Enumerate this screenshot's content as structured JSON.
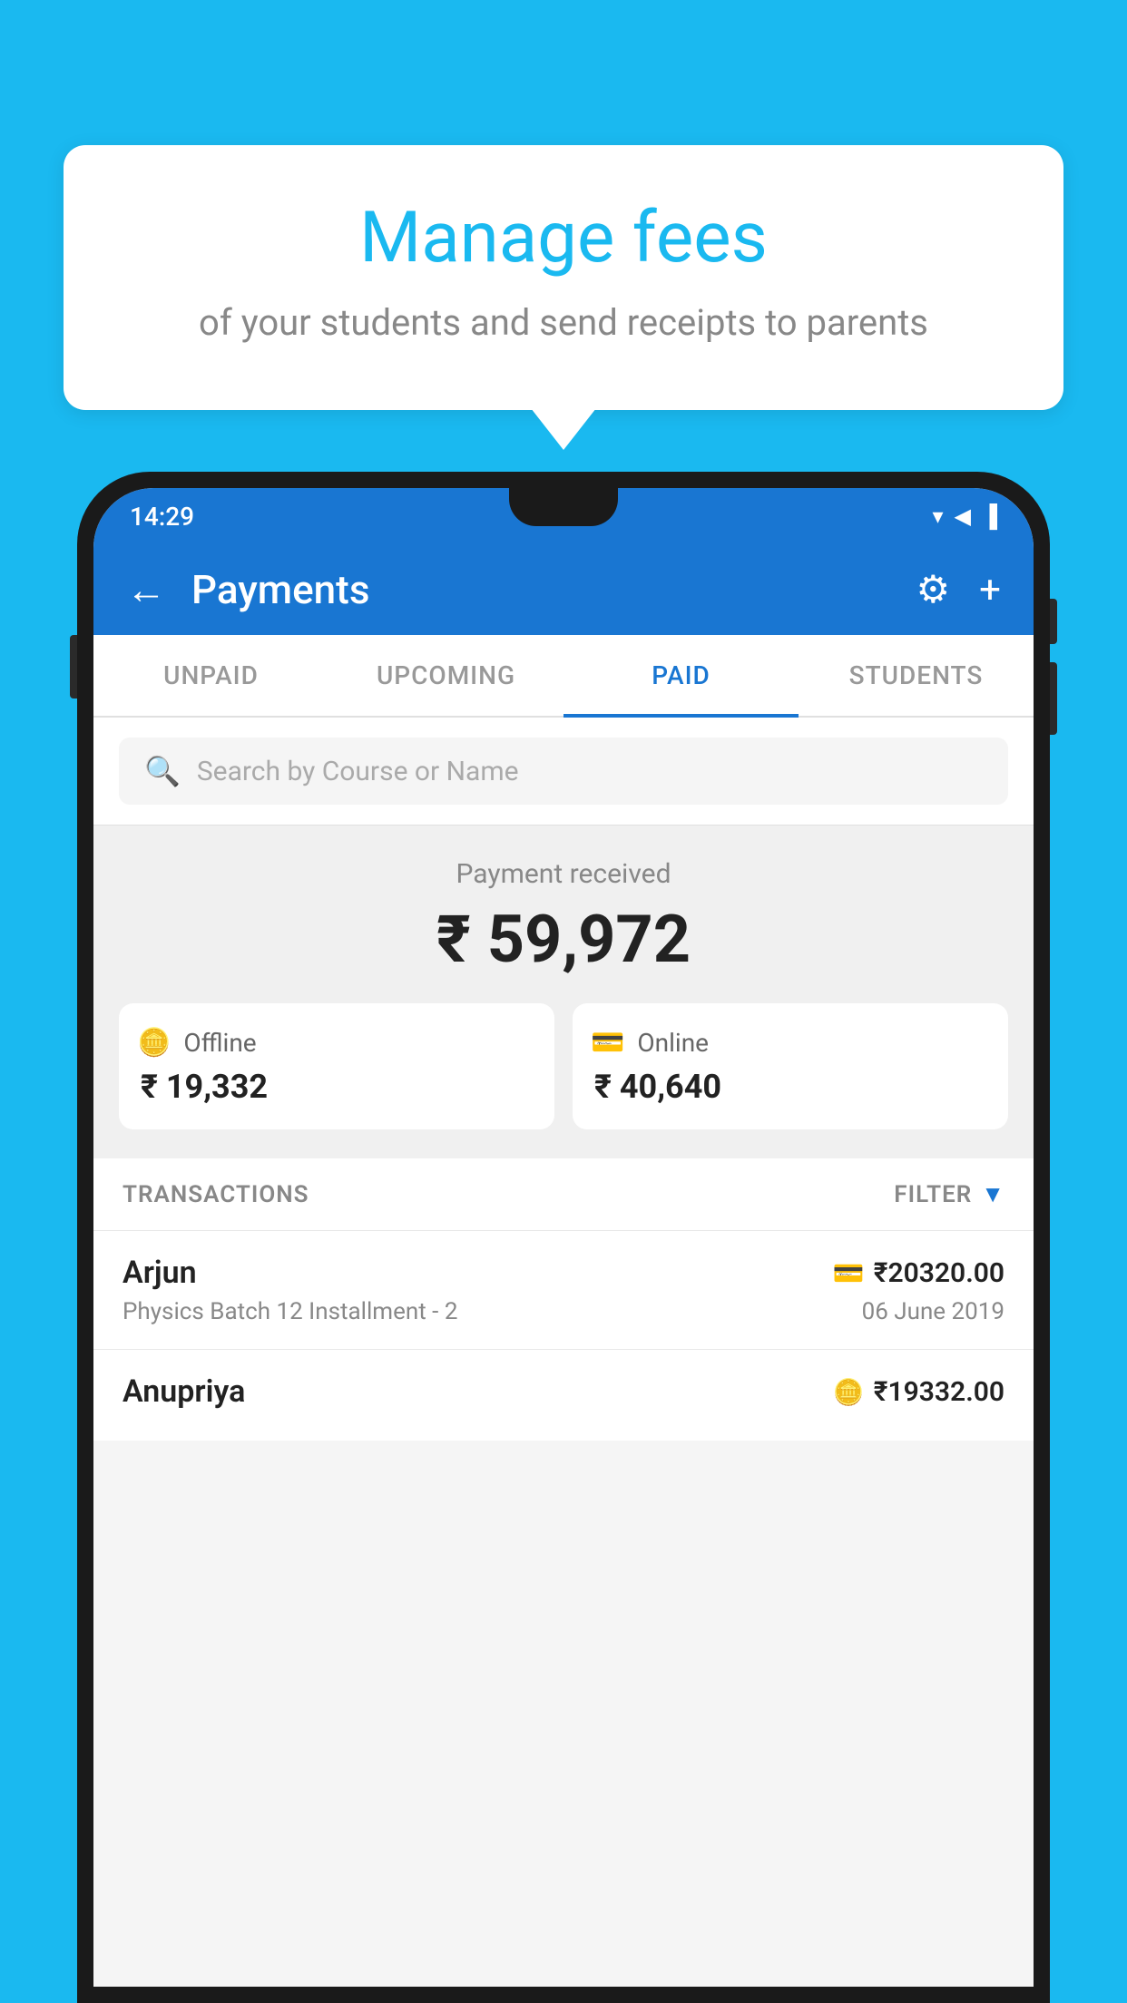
{
  "bubble": {
    "title": "Manage fees",
    "subtitle": "of your students and send receipts to parents"
  },
  "status_bar": {
    "time": "14:29"
  },
  "app_bar": {
    "title": "Payments",
    "back_label": "←",
    "settings_label": "⚙",
    "add_label": "+"
  },
  "tabs": [
    {
      "label": "UNPAID",
      "active": false
    },
    {
      "label": "UPCOMING",
      "active": false
    },
    {
      "label": "PAID",
      "active": true
    },
    {
      "label": "STUDENTS",
      "active": false
    }
  ],
  "search": {
    "placeholder": "Search by Course or Name"
  },
  "payment_summary": {
    "label": "Payment received",
    "amount": "₹ 59,972",
    "offline": {
      "label": "Offline",
      "amount": "₹ 19,332"
    },
    "online": {
      "label": "Online",
      "amount": "₹ 40,640"
    }
  },
  "transactions": {
    "label": "TRANSACTIONS",
    "filter_label": "FILTER",
    "rows": [
      {
        "name": "Arjun",
        "description": "Physics Batch 12 Installment - 2",
        "amount": "₹20320.00",
        "date": "06 June 2019",
        "type": "online"
      },
      {
        "name": "Anupriya",
        "description": "",
        "amount": "₹19332.00",
        "date": "",
        "type": "offline"
      }
    ]
  },
  "icons": {
    "wifi": "▲",
    "signal": "▲",
    "battery": "▮"
  }
}
